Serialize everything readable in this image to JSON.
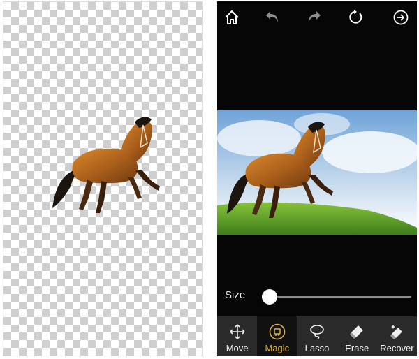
{
  "editor": {
    "topbar": {
      "icons": [
        "home-icon",
        "undo-icon",
        "redo-icon",
        "reset-icon",
        "next-icon"
      ]
    },
    "size": {
      "label": "Size",
      "value": 0.05
    },
    "tools": [
      {
        "label": "Move",
        "icon": "move-icon",
        "active": false
      },
      {
        "label": "Magic",
        "icon": "magic-icon",
        "active": true
      },
      {
        "label": "Lasso",
        "icon": "lasso-icon",
        "active": false
      },
      {
        "label": "Erase",
        "icon": "erase-icon",
        "active": false
      },
      {
        "label": "Recover",
        "icon": "recover-icon",
        "active": false
      }
    ],
    "colors": {
      "accent": "#e3b43c",
      "toolbar": "#2a2a2a",
      "background": "#060606"
    }
  }
}
